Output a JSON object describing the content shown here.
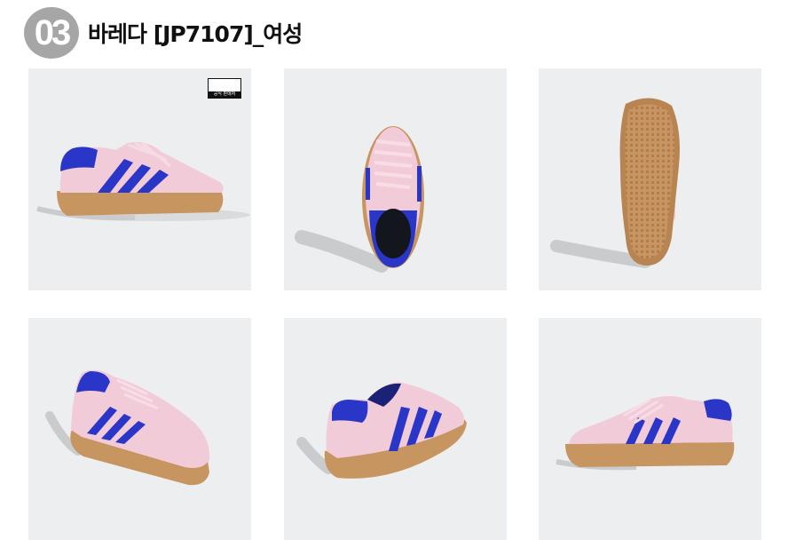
{
  "header": {
    "number": "03",
    "title": "바레다 [JP7107]_여성"
  },
  "badge": {
    "label": "공식 판매처",
    "icon": "adidas-logo-icon"
  },
  "colors": {
    "tile_background": "#eceef0",
    "upper_pink": "#f2cbd9",
    "stripe_blue": "#2a36c8",
    "gum_sole": "#c79560",
    "badge_grey": "#a6a6a6"
  },
  "products": [
    {
      "view": "side-left",
      "icon": "shoe-side-view-icon"
    },
    {
      "view": "top",
      "icon": "shoe-top-view-icon"
    },
    {
      "view": "sole",
      "icon": "shoe-sole-view-icon"
    },
    {
      "view": "front-angle",
      "icon": "shoe-front-angle-icon"
    },
    {
      "view": "back-angle",
      "icon": "shoe-back-angle-icon"
    },
    {
      "view": "side-right",
      "icon": "shoe-side-right-icon"
    }
  ]
}
